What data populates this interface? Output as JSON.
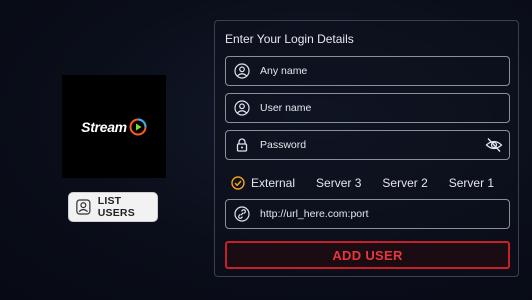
{
  "logo": {
    "text": "Stream",
    "accent_color": "#ff5a1f"
  },
  "list_users": {
    "label": "LIST USERS",
    "icon": "user-list-icon"
  },
  "form": {
    "title": "Enter Your Login Details",
    "any_name_placeholder": "Any name",
    "user_name_placeholder": "User name",
    "password_placeholder": "Password",
    "url_placeholder": "http://url_here.com:port",
    "servers": [
      {
        "label": "External",
        "selected": true
      },
      {
        "label": "Server 3",
        "selected": false
      },
      {
        "label": "Server 2",
        "selected": false
      },
      {
        "label": "Server 1",
        "selected": false
      }
    ],
    "add_user_label": "ADD USER",
    "accent_color": "#e8363c",
    "check_color": "#f0a020"
  }
}
